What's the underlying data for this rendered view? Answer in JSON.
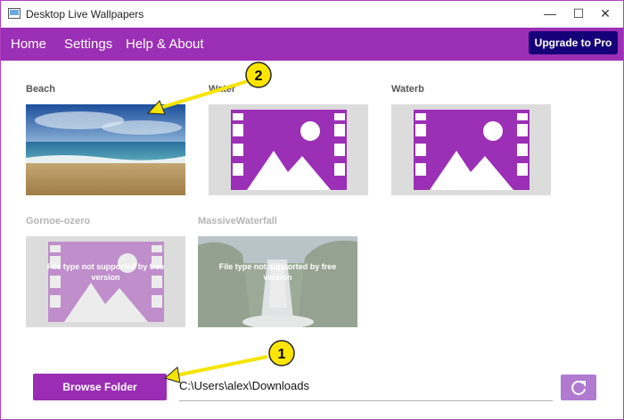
{
  "window": {
    "title": "Desktop Live Wallpapers",
    "controls": {
      "minimize": "—",
      "maximize": "☐",
      "close": "✕"
    }
  },
  "nav": {
    "items": [
      "Home",
      "Settings",
      "Help & About"
    ],
    "upgrade_label": "Upgrade to Pro"
  },
  "wallpapers": [
    {
      "name": "Beach",
      "thumbnail": "beach-photo",
      "supported": true
    },
    {
      "name": "Water",
      "thumbnail": "placeholder-icon",
      "supported": true
    },
    {
      "name": "Waterb",
      "thumbnail": "placeholder-icon",
      "supported": true
    },
    {
      "name": "Gornoe-ozero",
      "thumbnail": "placeholder-icon",
      "supported": false,
      "overlay": "File type not supported by free version"
    },
    {
      "name": "MassiveWaterfall",
      "thumbnail": "waterfall-photo",
      "supported": false,
      "overlay": "File type not supported by free version"
    }
  ],
  "footer": {
    "browse_label": "Browse Folder",
    "folder_path": "C:\\Users\\alex\\Downloads",
    "refresh_icon": "refresh-icon"
  },
  "annotations": {
    "badge_1": "1",
    "badge_2": "2"
  },
  "colors": {
    "accent": "#9b2fb5",
    "upgrade": "#16007a",
    "badge": "#ffe600"
  }
}
